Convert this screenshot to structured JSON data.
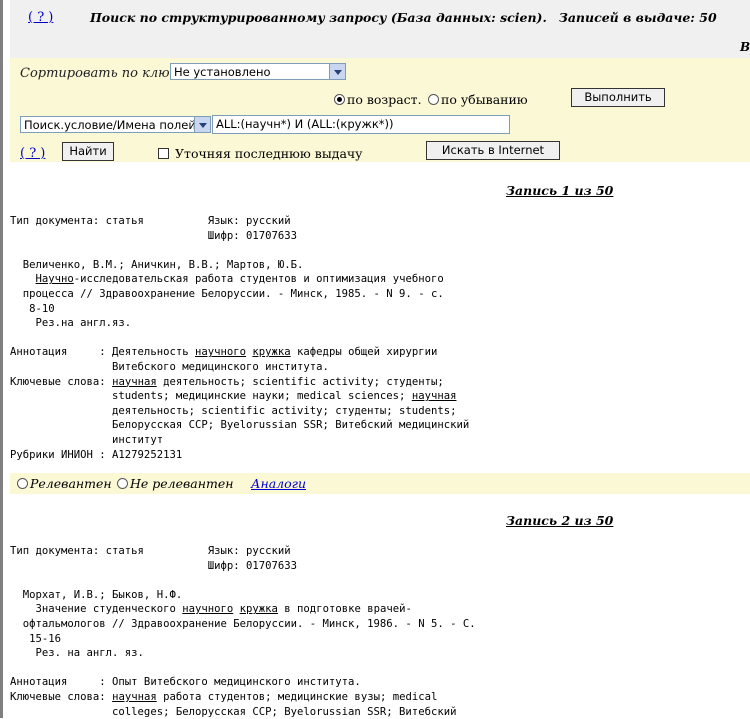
{
  "header": {
    "help_label": "( ? )",
    "title": "Поиск по структурированному запросу (База данных: scien).",
    "count_text": "Записей в выдаче: 50",
    "cut_text": "В"
  },
  "sort": {
    "label": "Сортировать по ключу",
    "selected": "Не установлено",
    "asc_label": "по возраст.",
    "desc_label": "по убыванию",
    "asc_selected": true,
    "execute_label": "Выполнить"
  },
  "query": {
    "field_selected": "Поиск.условие/Имена полей",
    "value": "ALL:(научн*) И (ALL:(кружк*))",
    "help_label": "( ? )",
    "find_label": "Найти",
    "refine_label": "Уточняя последнюю выдачу",
    "internet_label": "Искать в Internet"
  },
  "records": [
    {
      "heading": "Запись 1 из 50",
      "lines": [
        [
          {
            "t": "Тип документа: статья          Язык: русский"
          }
        ],
        [
          {
            "t": "                               Шифр: 01707633"
          }
        ],
        [
          {
            "t": ""
          }
        ],
        [
          {
            "t": "  Величенко, В.М.; Аничкин, В.В.; Мартов, Ю.Б."
          }
        ],
        [
          {
            "t": "    "
          },
          {
            "t": "Научно",
            "u": true
          },
          {
            "t": "-исследовательская работа студентов и оптимизация учебного"
          }
        ],
        [
          {
            "t": "  процесса // Здравоохранение Белоруссии. - Минск, 1985. - N 9. - с."
          }
        ],
        [
          {
            "t": "   8-10"
          }
        ],
        [
          {
            "t": "    Рез.на англ.яз."
          }
        ],
        [
          {
            "t": ""
          }
        ],
        [
          {
            "t": "Аннотация     : Деятельность "
          },
          {
            "t": "научного",
            "u": true
          },
          {
            "t": " "
          },
          {
            "t": "кружка",
            "u": true
          },
          {
            "t": " кафедры общей хирургии"
          }
        ],
        [
          {
            "t": "                Витебского медицинского института."
          }
        ],
        [
          {
            "t": "Ключевые слова: "
          },
          {
            "t": "научная",
            "u": true
          },
          {
            "t": " деятельность; scientific activity; студенты;"
          }
        ],
        [
          {
            "t": "                students; медицинские науки; medical sciences; "
          },
          {
            "t": "научная",
            "u": true
          }
        ],
        [
          {
            "t": "                деятельность; scientific activity; студенты; students;"
          }
        ],
        [
          {
            "t": "                Белорусская ССР; Byelorussian SSR; Витебский медицинский"
          }
        ],
        [
          {
            "t": "                институт"
          }
        ],
        [
          {
            "t": "Рубрики ИНИОН : А1279252131"
          }
        ]
      ]
    },
    {
      "heading": "Запись 2 из 50",
      "lines": [
        [
          {
            "t": "Тип документа: статья          Язык: русский"
          }
        ],
        [
          {
            "t": "                               Шифр: 01707633"
          }
        ],
        [
          {
            "t": ""
          }
        ],
        [
          {
            "t": "  Морхат, И.В.; Быков, Н.Ф."
          }
        ],
        [
          {
            "t": "    Значение студенческого "
          },
          {
            "t": "научного",
            "u": true
          },
          {
            "t": " "
          },
          {
            "t": "кружка",
            "u": true
          },
          {
            "t": " в подготовке врачей-"
          }
        ],
        [
          {
            "t": "  офтальмологов // Здравоохранение Белоруссии. - Минск, 1986. - N 5. - С."
          }
        ],
        [
          {
            "t": "   15-16"
          }
        ],
        [
          {
            "t": "    Рез. на англ. яз."
          }
        ],
        [
          {
            "t": ""
          }
        ],
        [
          {
            "t": "Аннотация     : Опыт Витебского медицинского института."
          }
        ],
        [
          {
            "t": "Ключевые слова: "
          },
          {
            "t": "научная",
            "u": true
          },
          {
            "t": " работа студентов; медицинские вузы; medical"
          }
        ],
        [
          {
            "t": "                colleges; Белорусская ССР; Byelorussian SSR; Витебский"
          }
        ]
      ]
    }
  ],
  "relevance": {
    "relevant_label": "Релевантен",
    "not_relevant_label": "Не релевантен",
    "analogs_label": "Аналоги"
  }
}
